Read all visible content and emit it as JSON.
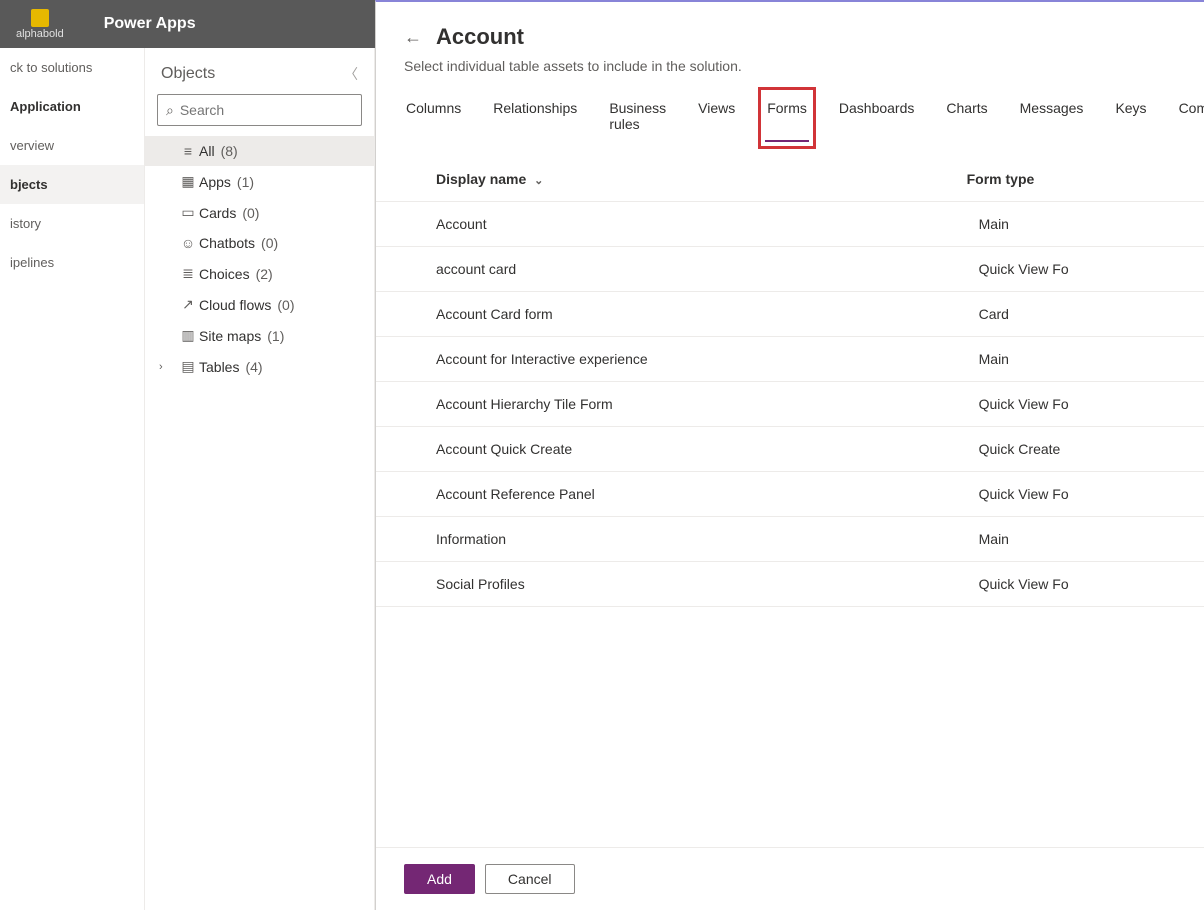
{
  "header": {
    "brand": "alphabold",
    "app_title": "Power Apps"
  },
  "leftnav": {
    "back": "ck to solutions",
    "section": "Application",
    "overview": "verview",
    "objects": "bjects",
    "history": "istory",
    "pipelines": "ipelines"
  },
  "objects_panel": {
    "title": "Objects",
    "search_placeholder": "Search",
    "items": [
      {
        "label": "All",
        "count": "(8)",
        "active": true
      },
      {
        "label": "Apps",
        "count": "(1)"
      },
      {
        "label": "Cards",
        "count": "(0)"
      },
      {
        "label": "Chatbots",
        "count": "(0)"
      },
      {
        "label": "Choices",
        "count": "(2)"
      },
      {
        "label": "Cloud flows",
        "count": "(0)"
      },
      {
        "label": "Site maps",
        "count": "(1)"
      },
      {
        "label": "Tables",
        "count": "(4)",
        "expandable": true
      }
    ]
  },
  "modal": {
    "title": "Account",
    "subtitle": "Select individual table assets to include in the solution.",
    "tabs": [
      "Columns",
      "Relationships",
      "Business rules",
      "Views",
      "Forms",
      "Dashboards",
      "Charts",
      "Messages",
      "Keys",
      "Commands"
    ],
    "active_tab": "Forms",
    "columns": {
      "name": "Display name",
      "type": "Form type"
    },
    "rows": [
      {
        "name": "Account",
        "type": "Main"
      },
      {
        "name": "account card",
        "type": "Quick View Fo"
      },
      {
        "name": "Account Card form",
        "type": "Card"
      },
      {
        "name": "Account for Interactive experience",
        "type": "Main"
      },
      {
        "name": "Account Hierarchy Tile Form",
        "type": "Quick View Fo"
      },
      {
        "name": "Account Quick Create",
        "type": "Quick Create"
      },
      {
        "name": "Account Reference Panel",
        "type": "Quick View Fo"
      },
      {
        "name": "Information",
        "type": "Main"
      },
      {
        "name": "Social Profiles",
        "type": "Quick View Fo"
      }
    ],
    "footer": {
      "add": "Add",
      "cancel": "Cancel"
    }
  }
}
